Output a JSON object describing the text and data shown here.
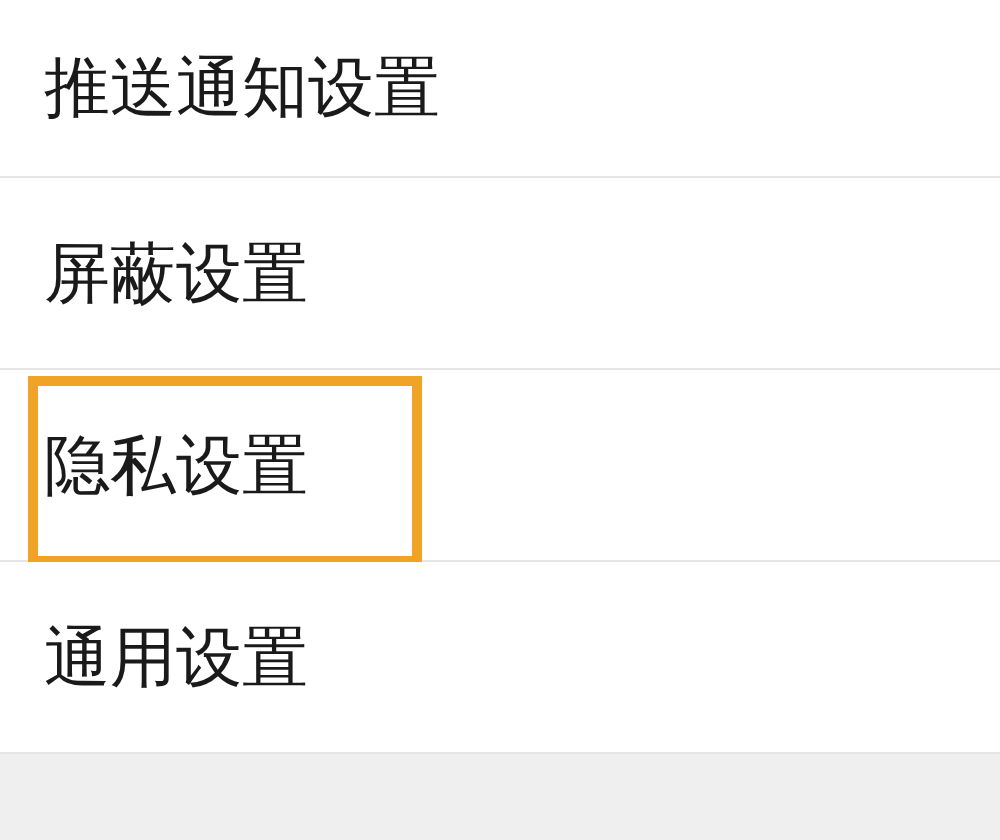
{
  "settings_list": [
    {
      "label": "推送通知设置",
      "highlighted": false
    },
    {
      "label": "屏蔽设置",
      "highlighted": false
    },
    {
      "label": "隐私设置",
      "highlighted": true
    },
    {
      "label": "通用设置",
      "highlighted": false
    }
  ]
}
